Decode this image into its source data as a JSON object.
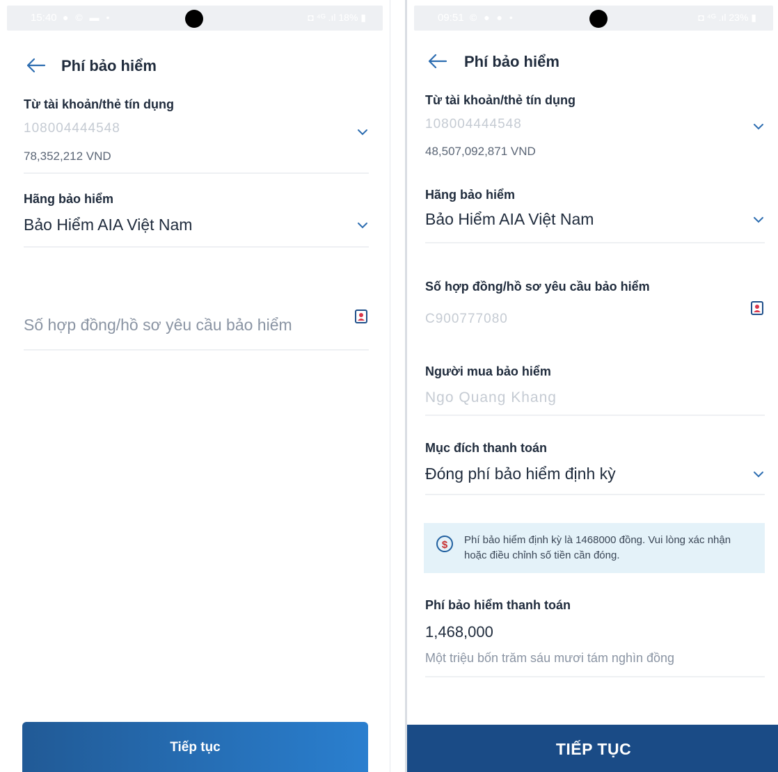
{
  "left": {
    "status": {
      "time": "15:40",
      "icons": "● © ▬ •",
      "right": "◘ ⁴ᴳ .ıl 18% ▮"
    },
    "header": {
      "title": "Phí bảo hiểm"
    },
    "account": {
      "label": "Từ tài khoản/thẻ tín dụng",
      "number": "108004444548",
      "balance": "78,352,212 VND"
    },
    "insurer": {
      "label": "Hãng bảo hiểm",
      "value": "Bảo Hiểm AIA Việt Nam"
    },
    "contract": {
      "placeholder": "Số hợp đồng/hồ sơ yêu cầu bảo hiểm"
    },
    "button": {
      "label": "Tiếp tục"
    }
  },
  "right": {
    "status": {
      "time": "09:51",
      "icons": "© ● ● •",
      "right": "◘ ⁴ᴳ .ıl 23% ▮"
    },
    "header": {
      "title": "Phí bảo hiểm"
    },
    "account": {
      "label": "Từ tài khoản/thẻ tín dụng",
      "number": "108004444548",
      "balance": "48,507,092,871 VND"
    },
    "insurer": {
      "label": "Hãng bảo hiểm",
      "value": "Bảo Hiểm AIA Việt Nam"
    },
    "contract": {
      "label": "Số hợp đồng/hồ sơ yêu cầu bảo hiểm",
      "value": "C900777080"
    },
    "buyer": {
      "label": "Người mua bảo hiểm",
      "value": "Ngo Quang Khang"
    },
    "purpose": {
      "label": "Mục đích thanh toán",
      "value": "Đóng phí bảo hiểm định kỳ"
    },
    "notice": {
      "text": "Phí bảo hiểm định kỳ là 1468000 đồng. Vui lòng xác nhận hoặc điều chỉnh số tiền cần đóng."
    },
    "amount": {
      "label": "Phí bảo hiểm thanh toán",
      "value": "1,468,000",
      "words": "Một triệu bốn trăm sáu mươi tám nghìn đồng"
    },
    "button": {
      "label": "TIẾP TỤC"
    }
  },
  "colors": {
    "primary": "#1a4b86",
    "notice_bg": "#e4f2f9",
    "accent": "#2a7fcf"
  }
}
